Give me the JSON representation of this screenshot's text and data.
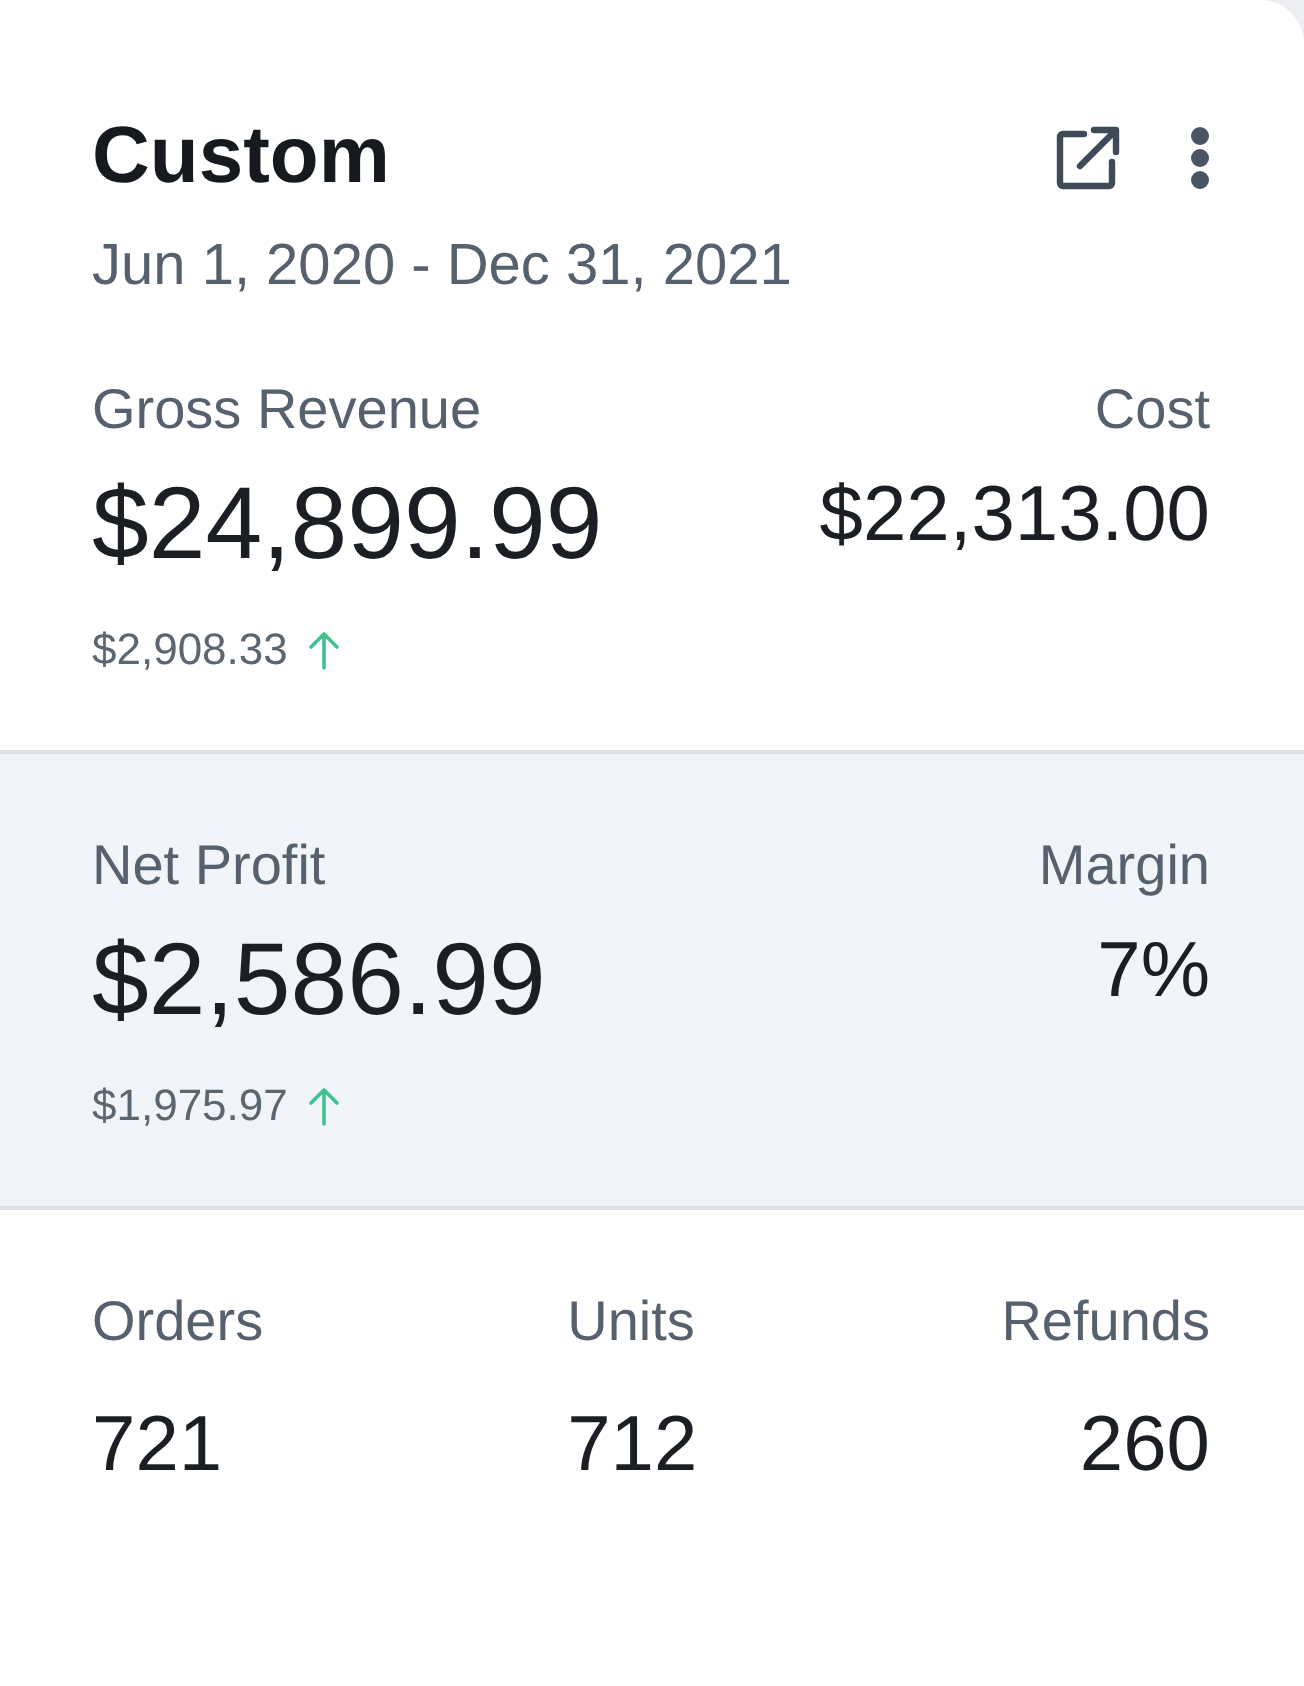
{
  "header": {
    "title": "Custom",
    "date_range": "Jun 1, 2020 - Dec 31, 2021"
  },
  "sections": [
    {
      "highlighted": false,
      "primary": {
        "label": "Gross Revenue",
        "value": "$24,899.99",
        "delta": "$2,908.33",
        "rising": true
      },
      "secondary": {
        "label": "Cost",
        "value": "$22,313.00"
      }
    },
    {
      "highlighted": true,
      "primary": {
        "label": "Net Profit",
        "value": "$2,586.99",
        "delta": "$1,975.97",
        "rising": true
      },
      "secondary": {
        "label": "Margin",
        "value": "7%"
      }
    }
  ],
  "counts": [
    {
      "label": "Orders",
      "value": "721"
    },
    {
      "label": "Units",
      "value": "712"
    },
    {
      "label": "Refunds",
      "value": "260"
    }
  ]
}
